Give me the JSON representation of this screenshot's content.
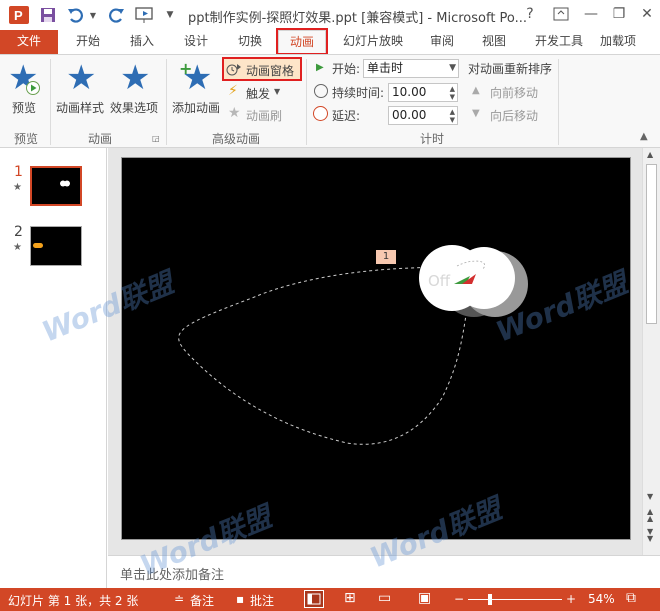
{
  "titlebar": {
    "title": "ppt制作实例-探照灯效果.ppt [兼容模式] - Microsoft Po...",
    "help": "?",
    "minimize": "—",
    "restore": "❐",
    "close": "✕"
  },
  "tabs": {
    "file": "文件",
    "home": "开始",
    "insert": "插入",
    "design": "设计",
    "transitions": "切换",
    "animations": "动画",
    "slideshow": "幻灯片放映",
    "review": "审阅",
    "view": "视图",
    "developer": "开发工具",
    "addins": "加载项"
  },
  "ribbon": {
    "preview_btn": "预览",
    "animation_styles_btn": "动画样式",
    "effect_options_btn": "效果选项",
    "add_animation_btn": "添加动画",
    "animation_pane_btn": "动画窗格",
    "trigger_btn": "触发",
    "animation_painter_btn": "动画刷",
    "start_label": "开始:",
    "start_value": "单击时",
    "duration_label": "持续时间:",
    "duration_value": "10.00",
    "delay_label": "延迟:",
    "delay_value": "00.00",
    "reorder_label": "对动画重新排序",
    "move_earlier_btn": "向前移动",
    "move_later_btn": "向后移动",
    "group_preview": "预览",
    "group_animation": "动画",
    "group_advanced": "高级动画",
    "group_timing": "计时"
  },
  "thumbs": [
    {
      "num": "1"
    },
    {
      "num": "2"
    }
  ],
  "slide": {
    "off_text": "Off",
    "motion_tag": "1"
  },
  "watermark": "Word联盟",
  "notes": {
    "placeholder": "单击此处添加备注"
  },
  "statusbar": {
    "slide_info": "幻灯片 第 1 张，共 2 张",
    "notes_btn": "备注",
    "comments_btn": "批注",
    "zoom": "54%"
  }
}
